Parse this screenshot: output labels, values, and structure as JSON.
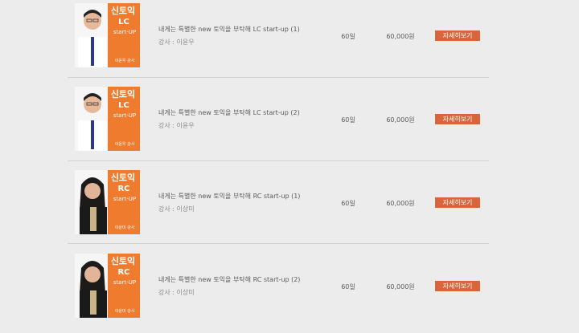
{
  "courses": [
    {
      "thumb": {
        "brand": "신토익",
        "sub": "LC",
        "sub2": "start-UP",
        "teacher": "이윤우 강사"
      },
      "title": "내게는 특별한 new 토익을 부탁해 LC start-up (1)",
      "instructor": "강사 : 이윤우",
      "days": "60일",
      "price": "60,000원",
      "button": "자세히보기"
    },
    {
      "thumb": {
        "brand": "신토익",
        "sub": "LC",
        "sub2": "start-UP",
        "teacher": "이윤우 강사"
      },
      "title": "내게는 특별한 new 토익을 부탁해 LC start-up (2)",
      "instructor": "강사 : 이윤우",
      "days": "60일",
      "price": "60,000원",
      "button": "자세히보기"
    },
    {
      "thumb": {
        "brand": "신토익",
        "sub": "RC",
        "sub2": "start-UP",
        "teacher": "이상미 강사"
      },
      "title": "내게는 특별한 new 토익을 부탁해 RC start-up (1)",
      "instructor": "강사 : 이상미",
      "days": "60일",
      "price": "60,000원",
      "button": "자세히보기"
    },
    {
      "thumb": {
        "brand": "신토익",
        "sub": "RC",
        "sub2": "start-UP",
        "teacher": "이상미 강사"
      },
      "title": "내게는 특별한 new 토익을 부탁해 RC start-up (2)",
      "instructor": "강사 : 이상미",
      "days": "60일",
      "price": "60,000원",
      "button": "자세히보기"
    }
  ],
  "colors": {
    "accent": "#ee7b2e",
    "button": "#d8663c",
    "background": "#ececec"
  }
}
